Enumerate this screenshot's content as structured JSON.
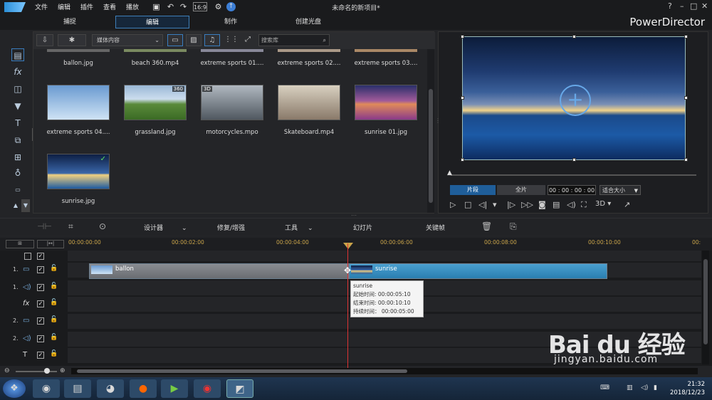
{
  "window": {
    "doc_title": "未命名的新项目*",
    "brand": "PowerDirector",
    "help": "?",
    "minimize": "–",
    "maximize": "□",
    "close": "✕"
  },
  "menu": [
    "文件",
    "编辑",
    "插件",
    "查看",
    "播放"
  ],
  "modes": [
    {
      "label": "捕捉"
    },
    {
      "label": "编辑"
    },
    {
      "label": "制作"
    },
    {
      "label": "创建光盘"
    }
  ],
  "library": {
    "dropdown": "媒体内容",
    "search_placeholder": "搜索库",
    "top_row": [
      "ballon.jpg",
      "beach 360.mp4",
      "extreme sports 01....",
      "extreme sports 02....",
      "extreme sports 03...."
    ],
    "items": [
      {
        "label": "extreme sports 04....",
        "badge": ""
      },
      {
        "label": "grassland.jpg",
        "badge": "360"
      },
      {
        "label": "motorcycles.mpo",
        "badge": "3D"
      },
      {
        "label": "Skateboard.mp4",
        "badge": ""
      },
      {
        "label": "sunrise 01.jpg",
        "badge": ""
      },
      {
        "label": "sunrise.jpg",
        "badge": "✓"
      }
    ]
  },
  "preview": {
    "clip_btn": "片段",
    "full_btn": "全片",
    "timecode": "00 : 00 : 00 : 00",
    "fit": "适合大小",
    "mode3d": "3D"
  },
  "edit_toolbar": {
    "designer": "设计器",
    "fix": "修复/增强",
    "tools": "工具",
    "slideshow": "幻灯片",
    "keyframe": "关键帧"
  },
  "ruler": [
    "00:00:00:00",
    "00:00:02:00",
    "00:00:04:00",
    "00:00:06:00",
    "00:00:08:00",
    "00:00:10:00",
    "00:"
  ],
  "tracks": [
    {
      "num": "1.",
      "icon": "▭"
    },
    {
      "num": "1.",
      "icon": "◁)"
    },
    {
      "num": "",
      "icon": "fx"
    },
    {
      "num": "2.",
      "icon": "▭"
    },
    {
      "num": "2.",
      "icon": "◁)"
    },
    {
      "num": "",
      "icon": "T"
    }
  ],
  "clips": {
    "clip1": "ballon",
    "clip2": "sunrise"
  },
  "tooltip": {
    "name": "sunrise",
    "start": "起始时间: 00:00:05:10",
    "end": "结束时间: 00:00:10:10",
    "duration": "持续时间： 00:00:05:00"
  },
  "taskbar": {
    "time": "21:32",
    "date": "2018/12/23"
  },
  "watermark": {
    "logo": "Bai du 经验",
    "url": "jingyan.baidu.com"
  }
}
